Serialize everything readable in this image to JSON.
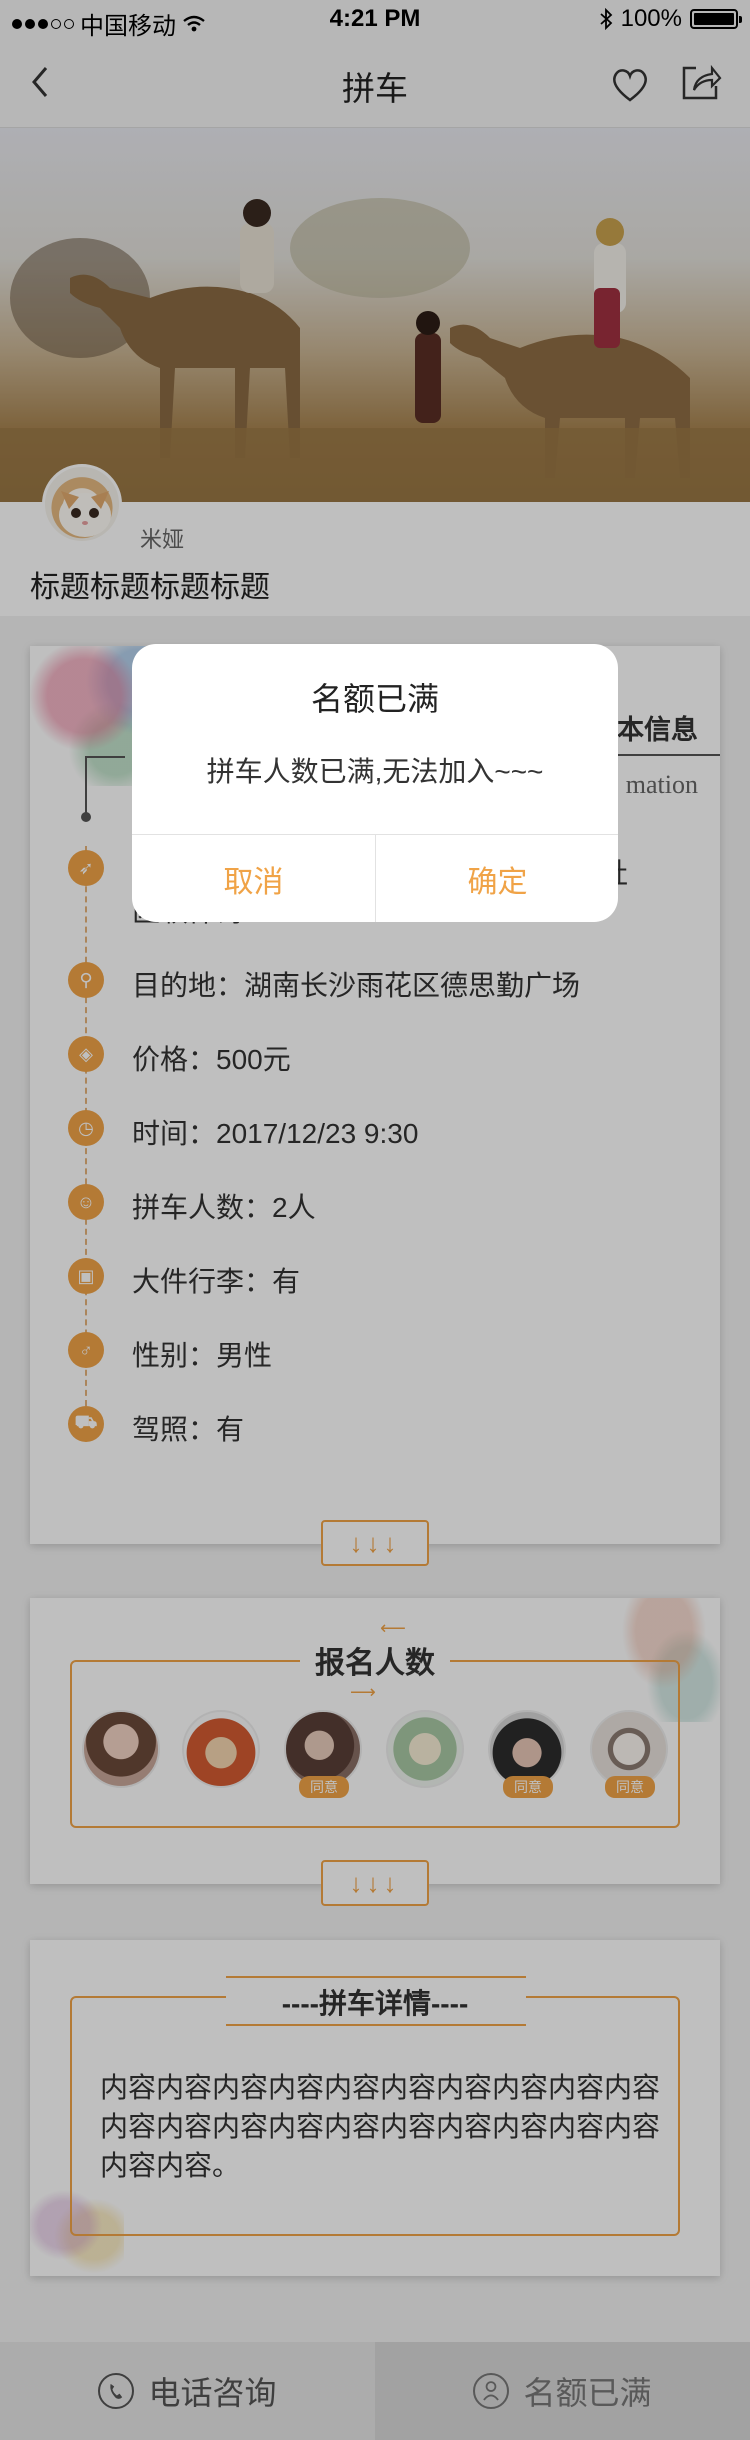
{
  "status_bar": {
    "carrier": "中国移动",
    "time": "4:21 PM",
    "battery": "100%"
  },
  "nav": {
    "title": "拼车"
  },
  "post": {
    "author": "米娅",
    "title": "标题标题标题标题"
  },
  "info": {
    "heading": "本信息",
    "subheading": "mation",
    "rows": [
      {
        "icon": "rocket-icon",
        "text": "社",
        "text2": "区软件诗"
      },
      {
        "icon": "location-icon",
        "text": "目的地：湖南长沙雨花区德思勤广场"
      },
      {
        "icon": "price-tag-icon",
        "text": "价格：500元"
      },
      {
        "icon": "clock-icon",
        "text": "时间：2017/12/23  9:30"
      },
      {
        "icon": "person-icon",
        "text": "拼车人数：2人"
      },
      {
        "icon": "luggage-icon",
        "text": "大件行李：有"
      },
      {
        "icon": "gender-icon",
        "text": "性别：男性"
      },
      {
        "icon": "car-icon",
        "text": "驾照：有"
      }
    ],
    "expand": "↓↓↓"
  },
  "signup": {
    "title": "报名人数",
    "badge": "同意",
    "avatars": [
      {
        "agree": false,
        "color": "#c9a79a"
      },
      {
        "agree": false,
        "color": "#d35b32"
      },
      {
        "agree": true,
        "color": "#8a6f66"
      },
      {
        "agree": false,
        "color": "#cfe0d0"
      },
      {
        "agree": true,
        "color": "#2c2c2c"
      },
      {
        "agree": true,
        "color": "#e8e2dc"
      }
    ],
    "expand": "↓↓↓"
  },
  "detail": {
    "title": "----拼车详情----",
    "content": "内容内容内容内容内容内容内容内容内容内容内容内容内容内容内容内容内容内容内容内容内容内容。"
  },
  "bottom": {
    "call_label": "电话咨询",
    "full_label": "名额已满"
  },
  "dialog": {
    "title": "名额已满",
    "message": "拼车人数已满,无法加入~~~",
    "cancel": "取消",
    "confirm": "确定"
  },
  "colors": {
    "accent": "#f0a347",
    "overlay": "rgba(0,0,0,0.25)"
  }
}
